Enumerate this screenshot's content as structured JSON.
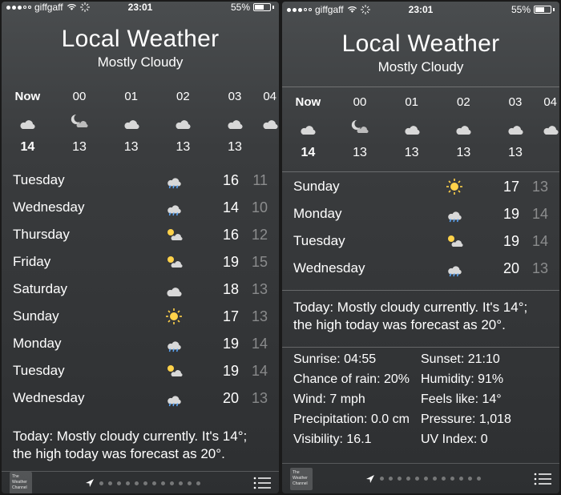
{
  "statusbar": {
    "carrier": "giffgaff",
    "time": "23:01",
    "battery_pct": "55%"
  },
  "title": "Local Weather",
  "subtitle": "Mostly Cloudy",
  "hourly_labels": [
    "Now",
    "00",
    "01",
    "02",
    "03",
    "04"
  ],
  "hourly_temps": [
    "14",
    "13",
    "13",
    "13",
    "13",
    ""
  ],
  "hourly_icons": [
    "cloud",
    "partly-cloudy-night",
    "cloud",
    "cloud",
    "cloud",
    "cloud"
  ],
  "left": {
    "days": [
      {
        "name": "Tuesday",
        "icon": "rain",
        "hi": "16",
        "lo": "11"
      },
      {
        "name": "Wednesday",
        "icon": "rain",
        "hi": "14",
        "lo": "10"
      },
      {
        "name": "Thursday",
        "icon": "partly-cloudy",
        "hi": "16",
        "lo": "12"
      },
      {
        "name": "Friday",
        "icon": "partly-cloudy",
        "hi": "19",
        "lo": "15"
      },
      {
        "name": "Saturday",
        "icon": "cloud",
        "hi": "18",
        "lo": "13"
      },
      {
        "name": "Sunday",
        "icon": "sunny",
        "hi": "17",
        "lo": "13"
      },
      {
        "name": "Monday",
        "icon": "rain",
        "hi": "19",
        "lo": "14"
      },
      {
        "name": "Tuesday",
        "icon": "partly-cloudy",
        "hi": "19",
        "lo": "14"
      },
      {
        "name": "Wednesday",
        "icon": "rain",
        "hi": "20",
        "lo": "13"
      }
    ],
    "summary": "Today: Mostly cloudy currently. It's 14°; the high today was forecast as 20°."
  },
  "right": {
    "days": [
      {
        "name": "Sunday",
        "icon": "sunny",
        "hi": "17",
        "lo": "13"
      },
      {
        "name": "Monday",
        "icon": "rain",
        "hi": "19",
        "lo": "14"
      },
      {
        "name": "Tuesday",
        "icon": "partly-cloudy",
        "hi": "19",
        "lo": "14"
      },
      {
        "name": "Wednesday",
        "icon": "rain",
        "hi": "20",
        "lo": "13"
      }
    ],
    "summary": "Today: Mostly cloudy currently. It's 14°; the high today was forecast as 20°.",
    "details": {
      "sunrise_l": "Sunrise:",
      "sunrise_v": "04:55",
      "sunset_l": "Sunset:",
      "sunset_v": "21:10",
      "rain_l": "Chance of rain:",
      "rain_v": "20%",
      "humid_l": "Humidity:",
      "humid_v": "91%",
      "wind_l": "Wind:",
      "wind_v": "7 mph",
      "feels_l": "Feels like:",
      "feels_v": "14°",
      "precip_l": "Precipitation:",
      "precip_v": "0.0 cm",
      "press_l": "Pressure:",
      "press_v": "1,018",
      "vis_l": "Visibility:",
      "vis_v": "16.1",
      "uv_l": "UV Index:",
      "uv_v": "0"
    }
  },
  "twc_label": "The Weather Channel",
  "dot_count": 12
}
